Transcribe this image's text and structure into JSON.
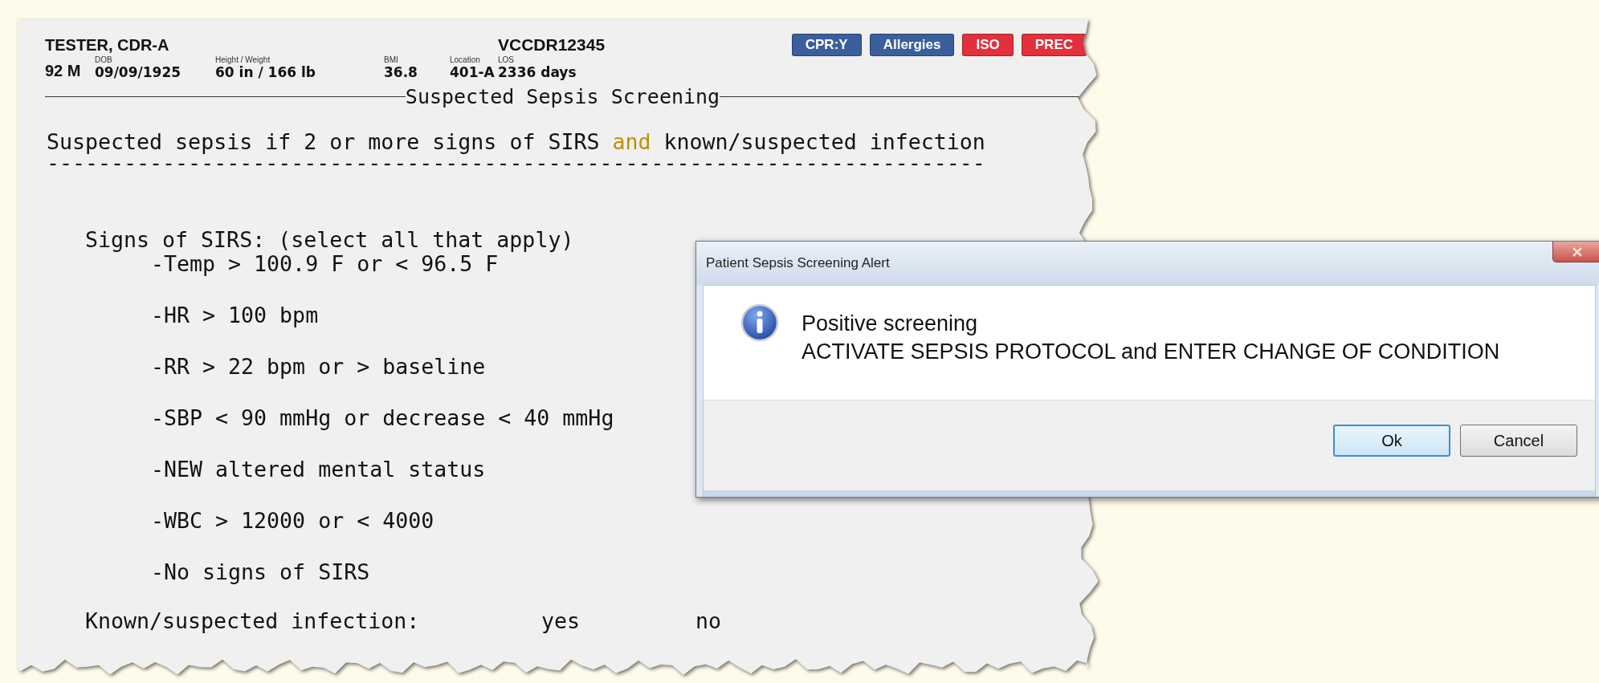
{
  "header": {
    "name": "TESTER, CDR-A",
    "mrn": "VCCDR12345",
    "age_sex": "92 M",
    "fields": [
      {
        "label": "DOB",
        "value": "09/09/1925"
      },
      {
        "label": "Height / Weight",
        "value": "60 in / 166 lb"
      },
      {
        "label": "BMI",
        "value": "36.8"
      },
      {
        "label": "Location",
        "value": "401-A"
      },
      {
        "label": "LOS",
        "value": "2336 days"
      }
    ],
    "badges": [
      {
        "label": "CPR:Y",
        "color": "#3b5f9c"
      },
      {
        "label": "Allergies",
        "color": "#3b5f9c"
      },
      {
        "label": "ISO",
        "color": "#e2313c"
      },
      {
        "label": "PREC",
        "color": "#e2313c"
      }
    ]
  },
  "screen": {
    "title": "Suspected Sepsis Screening",
    "criteria": {
      "before": "Suspected sepsis if 2 or more signs of SIRS ",
      "highlight": "and",
      "after": " known/suspected infection"
    },
    "divider": "-------------------------------------------------------------------------",
    "sirs": {
      "label": "Signs of SIRS: (select all that apply)",
      "items": [
        "-Temp > 100.9 F or < 96.5 F",
        "-HR > 100 bpm",
        "-RR > 22 bpm or > baseline",
        "-SBP < 90 mmHg or decrease < 40 mmHg",
        "-NEW altered mental status",
        "-WBC > 12000 or < 4000",
        "-No signs of SIRS"
      ]
    },
    "infection": {
      "label": "Known/suspected infection:",
      "options": [
        "yes",
        "no"
      ]
    }
  },
  "dialog": {
    "title": "Patient Sepsis Screening Alert",
    "message_lines": [
      "Positive screening",
      "ACTIVATE SEPSIS PROTOCOL and ENTER CHANGE OF CONDITION"
    ],
    "buttons": [
      {
        "label": "Ok",
        "focused": true
      },
      {
        "label": "Cancel",
        "focused": false
      }
    ]
  }
}
